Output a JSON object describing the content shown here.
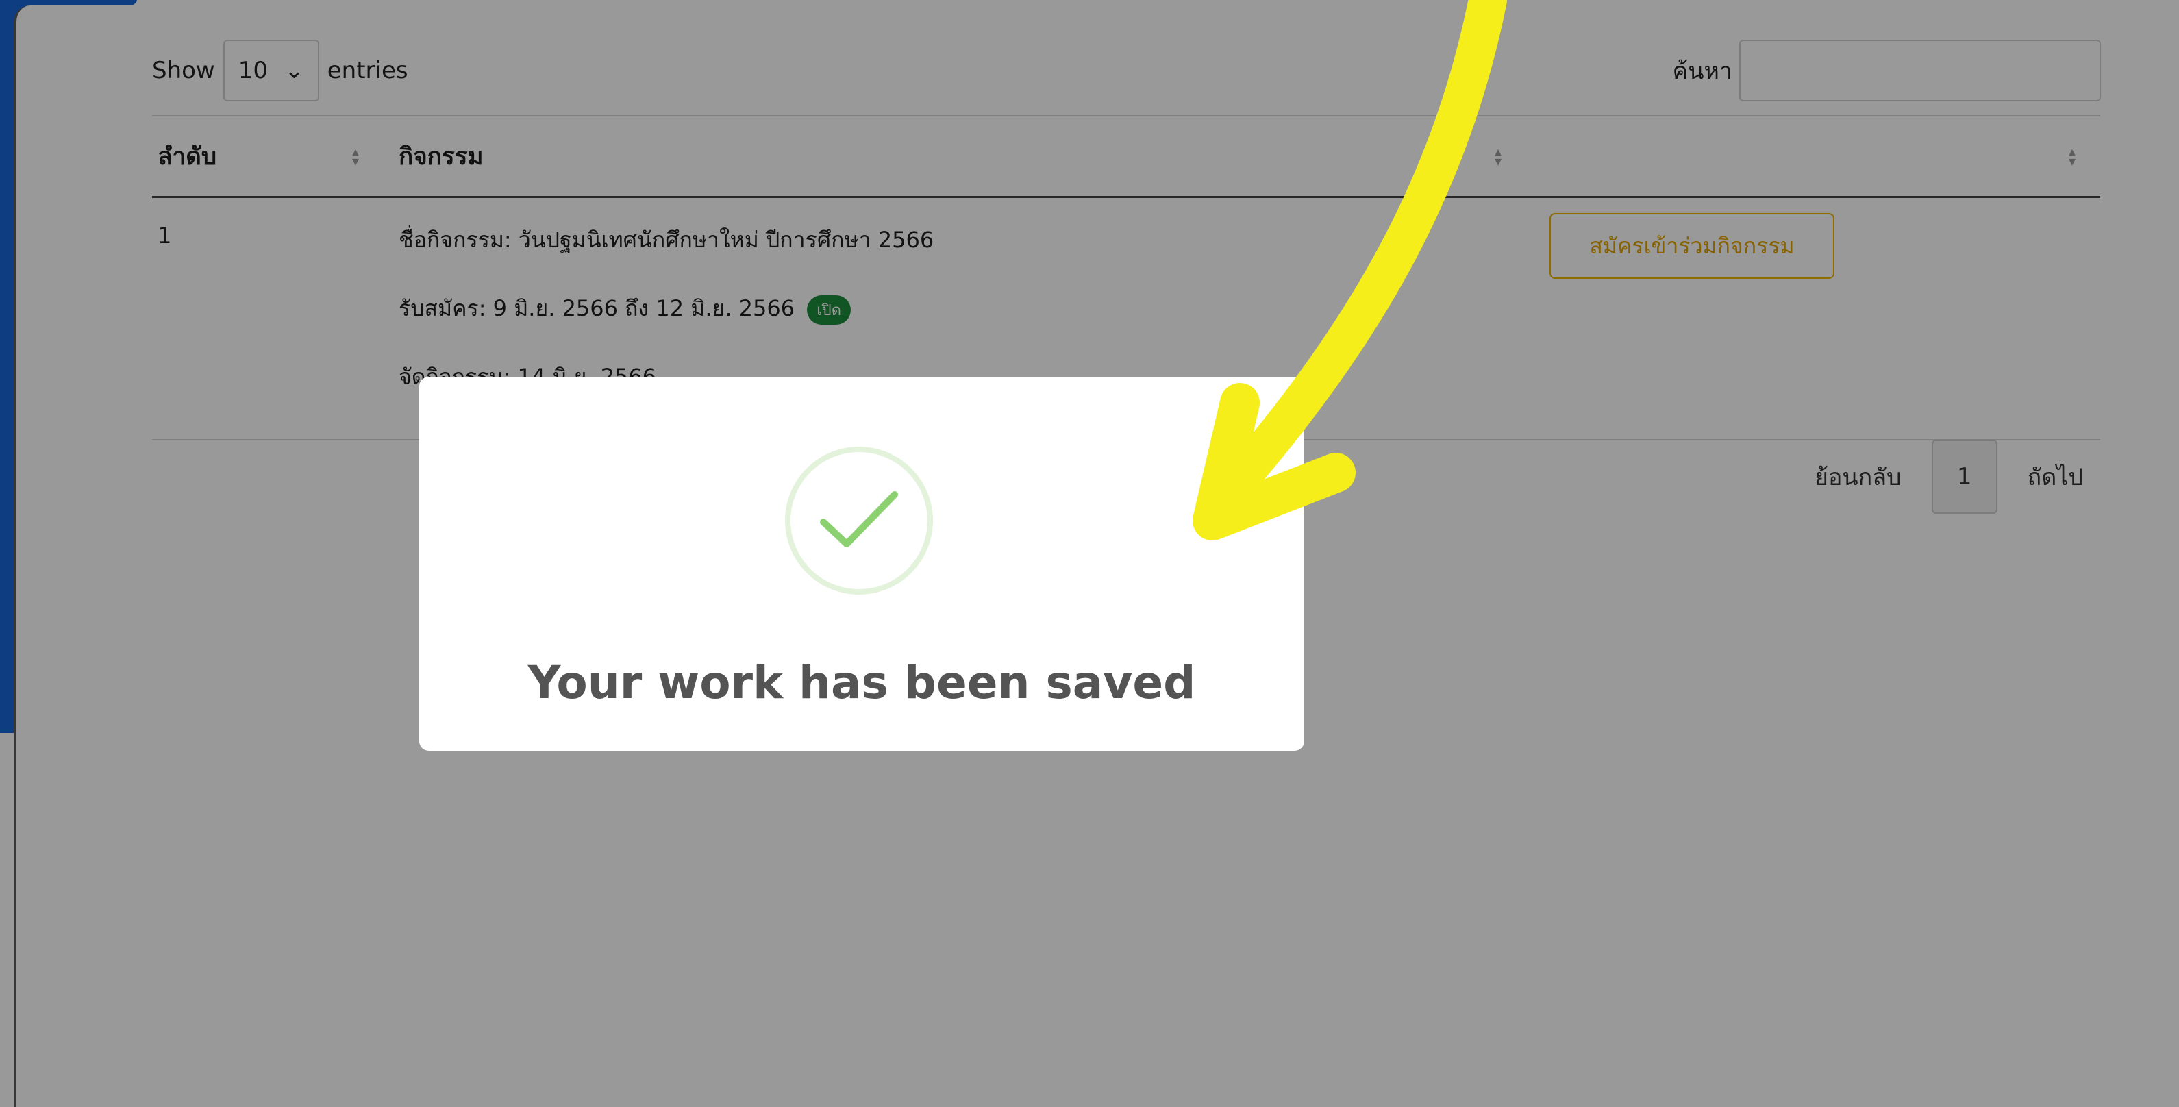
{
  "controls": {
    "show_label": "Show",
    "length_value": "10",
    "entries_label": "entries",
    "search_label": "ค้นหา",
    "search_value": ""
  },
  "table": {
    "headers": [
      "ลำดับ",
      "กิจกรรม",
      ""
    ],
    "rows": [
      {
        "index": "1",
        "name": "ชื่อกิจกรรม: วันปฐมนิเทศนักศึกษาใหม่ ปีการศึกษา 2566",
        "registration": "รับสมัคร: 9 มิ.ย. 2566 ถึง 12 มิ.ย. 2566",
        "status_badge": "เปิด",
        "event_date": "จัดกิจกรรม: 14 มิ.ย. 2566",
        "action_label": "สมัครเข้าร่วมกิจกรรม"
      }
    ]
  },
  "pagination": {
    "previous_label": "ย้อนกลับ",
    "current_page": "1",
    "next_label": "ถัดไป"
  },
  "modal": {
    "title": "Your work has been saved",
    "icon": "check-icon"
  },
  "colors": {
    "frame_blue": "#1a66d8",
    "arrow_yellow": "#f5ee1a",
    "badge_green": "#1e8e3e",
    "action_border": "#f0b400",
    "success_check": "#8bd16f"
  }
}
